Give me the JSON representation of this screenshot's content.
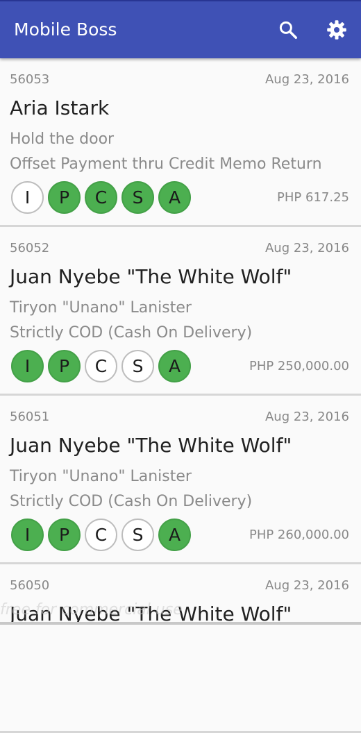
{
  "app": {
    "title": "Mobile Boss",
    "colors": {
      "primary": "#3f51b5",
      "status_on": "#4caf50",
      "status_off": "#ffffff"
    },
    "icons": {
      "search": "search-icon",
      "settings": "gear-icon"
    }
  },
  "orders": [
    {
      "id": "56053",
      "date": "Aug 23, 2016",
      "customer": "Aria Istark",
      "line1": "Hold the door",
      "line2": "Offset Payment thru Credit Memo Return",
      "statuses": [
        {
          "letter": "I",
          "active": false
        },
        {
          "letter": "P",
          "active": true
        },
        {
          "letter": "C",
          "active": true
        },
        {
          "letter": "S",
          "active": true
        },
        {
          "letter": "A",
          "active": true
        }
      ],
      "amount": "PHP 617.25"
    },
    {
      "id": "56052",
      "date": "Aug 23, 2016",
      "customer": "Juan Nyebe \"The White Wolf\"",
      "line1": "Tiryon \"Unano\" Lanister",
      "line2": "Strictly COD (Cash On Delivery)",
      "statuses": [
        {
          "letter": "I",
          "active": true
        },
        {
          "letter": "P",
          "active": true
        },
        {
          "letter": "C",
          "active": false
        },
        {
          "letter": "S",
          "active": false
        },
        {
          "letter": "A",
          "active": true
        }
      ],
      "amount": "PHP 250,000.00"
    },
    {
      "id": "56051",
      "date": "Aug 23, 2016",
      "customer": "Juan Nyebe \"The White Wolf\"",
      "line1": "Tiryon \"Unano\" Lanister",
      "line2": "Strictly COD (Cash On Delivery)",
      "statuses": [
        {
          "letter": "I",
          "active": true
        },
        {
          "letter": "P",
          "active": true
        },
        {
          "letter": "C",
          "active": false
        },
        {
          "letter": "S",
          "active": false
        },
        {
          "letter": "A",
          "active": true
        }
      ],
      "amount": "PHP 260,000.00"
    },
    {
      "id": "56050",
      "date": "Aug 23, 2016",
      "customer": "Juan Nyebe \"The White Wolf\"",
      "line1": "",
      "line2": "",
      "statuses": [],
      "amount": ""
    }
  ],
  "watermark": "free for commercial use"
}
